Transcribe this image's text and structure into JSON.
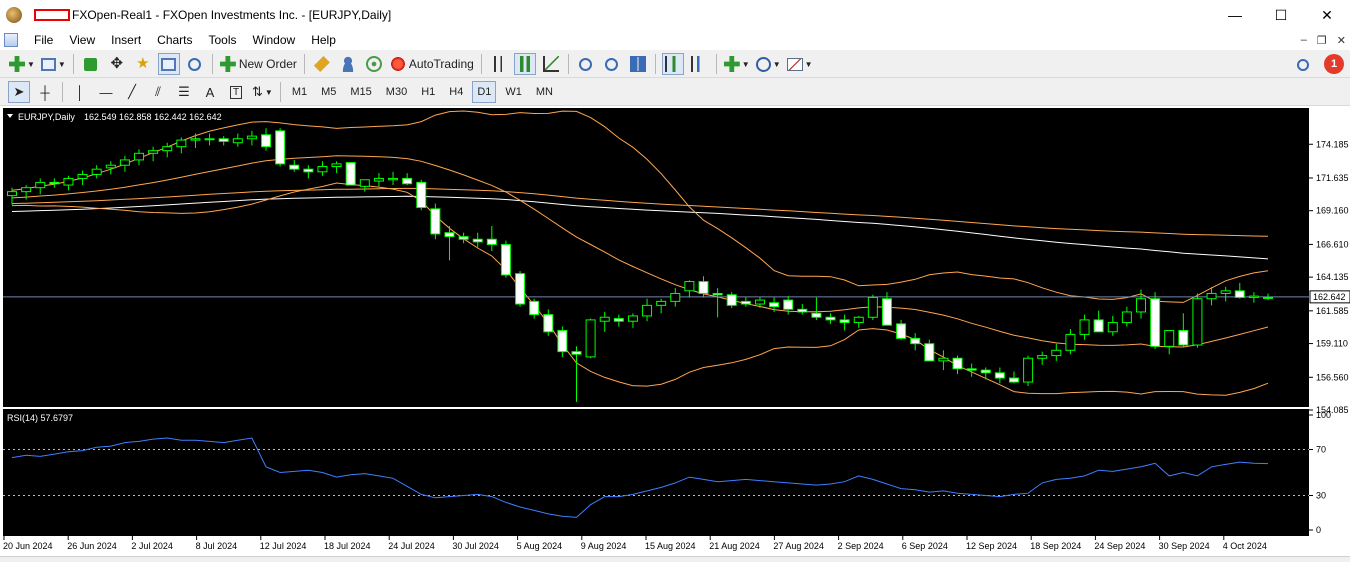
{
  "window": {
    "title": "FXOpen-Real1 - FXOpen Investments Inc. - [EURJPY,Daily]",
    "controls": {
      "minimize": "—",
      "maximize": "☐",
      "close": "✕"
    }
  },
  "menu": {
    "items": [
      "File",
      "View",
      "Insert",
      "Charts",
      "Tools",
      "Window",
      "Help"
    ],
    "mdi": {
      "minimize": "–",
      "restore": "❐",
      "close": "✕"
    }
  },
  "toolbar": {
    "new_order": "New Order",
    "auto_trading": "AutoTrading",
    "notification_count": "1"
  },
  "timeframes": [
    "M1",
    "M5",
    "M15",
    "M30",
    "H1",
    "H4",
    "D1",
    "W1",
    "MN"
  ],
  "active_timeframe": "D1",
  "colors": {
    "chart_bg": "#000000",
    "bull_candle": "#000000",
    "bear_candle": "#ffffff",
    "wick": "#00ff00",
    "bollinger": "#ffa64d",
    "ma": "#ffffff",
    "rsi_line": "#3f7fff",
    "current_price_line": "#6f87b0"
  },
  "chart": {
    "symbol_header": "EURJPY,Daily",
    "ohlc": "162.549 162.858 162.442 162.642",
    "current_price": "162.642",
    "price_axis": [
      "174.185",
      "171.635",
      "169.160",
      "166.610",
      "164.135",
      "161.585",
      "159.110",
      "156.560",
      "154.085"
    ],
    "date_axis": [
      "20 Jun 2024",
      "26 Jun 2024",
      "2 Jul 2024",
      "8 Jul 2024",
      "12 Jul 2024",
      "18 Jul 2024",
      "24 Jul 2024",
      "30 Jul 2024",
      "5 Aug 2024",
      "9 Aug 2024",
      "15 Aug 2024",
      "21 Aug 2024",
      "27 Aug 2024",
      "2 Sep 2024",
      "6 Sep 2024",
      "12 Sep 2024",
      "18 Sep 2024",
      "24 Sep 2024",
      "30 Sep 2024",
      "4 Oct 2024"
    ]
  },
  "rsi": {
    "label": "RSI(14) 57.6797",
    "axis": [
      "100",
      "70",
      "30",
      "0"
    ],
    "levels": [
      70,
      30
    ]
  },
  "chart_data": {
    "type": "candlestick",
    "y_range": [
      154.085,
      176.7
    ],
    "candles": [
      [
        170.3,
        170.9,
        169.6,
        170.6
      ],
      [
        170.6,
        171.1,
        170.0,
        170.9
      ],
      [
        170.9,
        171.6,
        170.4,
        171.3
      ],
      [
        171.3,
        171.6,
        170.9,
        171.2
      ],
      [
        171.1,
        171.8,
        170.7,
        171.6
      ],
      [
        171.6,
        172.2,
        171.1,
        171.9
      ],
      [
        171.9,
        172.6,
        171.6,
        172.3
      ],
      [
        172.4,
        172.9,
        171.9,
        172.6
      ],
      [
        172.6,
        173.3,
        172.1,
        173.0
      ],
      [
        173.0,
        173.8,
        172.6,
        173.5
      ],
      [
        173.5,
        174.0,
        172.9,
        173.7
      ],
      [
        173.7,
        174.3,
        173.2,
        174.0
      ],
      [
        174.0,
        174.7,
        173.5,
        174.5
      ],
      [
        174.5,
        175.0,
        173.9,
        174.6
      ],
      [
        174.6,
        175.0,
        174.1,
        174.6
      ],
      [
        174.6,
        174.8,
        174.1,
        174.4
      ],
      [
        174.3,
        175.0,
        174.0,
        174.6
      ],
      [
        174.6,
        175.2,
        174.1,
        174.8
      ],
      [
        174.9,
        175.4,
        173.7,
        174.0
      ],
      [
        175.2,
        175.4,
        172.5,
        172.7
      ],
      [
        172.6,
        173.0,
        172.1,
        172.3
      ],
      [
        172.3,
        172.6,
        171.6,
        172.1
      ],
      [
        172.1,
        172.9,
        171.8,
        172.5
      ],
      [
        172.5,
        172.9,
        172.0,
        172.7
      ],
      [
        172.8,
        172.8,
        171.2,
        171.1
      ],
      [
        171.0,
        171.4,
        170.6,
        171.5
      ],
      [
        171.4,
        172.0,
        171.0,
        171.6
      ],
      [
        171.5,
        172.1,
        171.1,
        171.6
      ],
      [
        171.6,
        172.0,
        171.1,
        171.2
      ],
      [
        171.3,
        171.5,
        169.2,
        169.4
      ],
      [
        169.3,
        169.7,
        167.0,
        167.4
      ],
      [
        167.5,
        168.0,
        165.4,
        167.2
      ],
      [
        167.2,
        167.5,
        166.7,
        167.0
      ],
      [
        167.0,
        167.5,
        166.4,
        166.8
      ],
      [
        167.0,
        168.0,
        166.1,
        166.6
      ],
      [
        166.6,
        166.9,
        164.1,
        164.3
      ],
      [
        164.4,
        164.6,
        161.9,
        162.1
      ],
      [
        162.3,
        162.5,
        161.0,
        161.3
      ],
      [
        161.3,
        161.7,
        159.7,
        160.0
      ],
      [
        160.1,
        160.4,
        158.1,
        158.5
      ],
      [
        158.5,
        158.9,
        154.7,
        158.3
      ],
      [
        158.1,
        161.0,
        158.0,
        160.9
      ],
      [
        160.8,
        161.5,
        160.0,
        161.1
      ],
      [
        161.0,
        161.3,
        160.4,
        160.8
      ],
      [
        160.8,
        161.4,
        160.3,
        161.2
      ],
      [
        161.2,
        162.5,
        160.8,
        162.0
      ],
      [
        162.0,
        162.5,
        161.4,
        162.3
      ],
      [
        162.3,
        163.3,
        161.9,
        162.9
      ],
      [
        163.1,
        163.9,
        162.6,
        163.8
      ],
      [
        163.8,
        164.2,
        162.6,
        162.9
      ],
      [
        162.9,
        163.3,
        161.1,
        162.8
      ],
      [
        162.8,
        163.0,
        161.8,
        162.0
      ],
      [
        162.3,
        162.6,
        161.9,
        162.1
      ],
      [
        162.1,
        162.6,
        161.8,
        162.4
      ],
      [
        162.2,
        162.6,
        161.5,
        161.9
      ],
      [
        162.4,
        162.7,
        161.3,
        161.7
      ],
      [
        161.7,
        162.1,
        161.3,
        161.5
      ],
      [
        161.4,
        162.6,
        160.9,
        161.1
      ],
      [
        161.1,
        161.4,
        160.6,
        160.9
      ],
      [
        160.9,
        161.3,
        160.1,
        160.7
      ],
      [
        160.7,
        161.2,
        160.3,
        161.1
      ],
      [
        161.1,
        162.8,
        160.9,
        162.6
      ],
      [
        162.5,
        163.0,
        161.0,
        160.5
      ],
      [
        160.6,
        160.9,
        159.4,
        159.5
      ],
      [
        159.5,
        159.9,
        158.6,
        159.1
      ],
      [
        159.1,
        159.4,
        157.9,
        157.8
      ],
      [
        157.8,
        158.6,
        157.1,
        158.0
      ],
      [
        158.0,
        158.2,
        156.8,
        157.2
      ],
      [
        157.2,
        157.6,
        156.6,
        157.1
      ],
      [
        157.1,
        157.3,
        156.4,
        156.9
      ],
      [
        156.9,
        157.3,
        156.1,
        156.5
      ],
      [
        156.5,
        157.0,
        156.1,
        156.2
      ],
      [
        156.2,
        158.2,
        155.9,
        158.0
      ],
      [
        158.0,
        158.5,
        157.5,
        158.2
      ],
      [
        158.2,
        159.1,
        157.8,
        158.6
      ],
      [
        158.6,
        160.2,
        158.3,
        159.8
      ],
      [
        159.8,
        161.3,
        159.4,
        160.9
      ],
      [
        160.9,
        161.6,
        160.3,
        160.0
      ],
      [
        160.0,
        161.2,
        159.7,
        160.7
      ],
      [
        160.7,
        161.9,
        160.4,
        161.5
      ],
      [
        161.5,
        163.2,
        161.0,
        162.5
      ],
      [
        162.5,
        163.0,
        158.7,
        158.9
      ],
      [
        158.9,
        159.4,
        158.3,
        160.1
      ],
      [
        160.1,
        161.4,
        158.8,
        159.0
      ],
      [
        159.0,
        162.9,
        158.8,
        162.5
      ],
      [
        162.5,
        163.4,
        162.0,
        162.9
      ],
      [
        162.9,
        163.4,
        162.3,
        163.1
      ],
      [
        163.1,
        163.7,
        162.5,
        162.6
      ],
      [
        162.6,
        163.0,
        162.2,
        162.7
      ],
      [
        162.6,
        162.9,
        162.4,
        162.6
      ]
    ],
    "rsi_values": [
      63,
      65,
      64,
      66,
      68,
      69,
      72,
      73,
      76,
      77,
      79,
      80,
      78,
      78,
      77,
      76,
      78,
      80,
      55,
      50,
      51,
      52,
      50,
      46,
      48,
      49,
      47,
      45,
      38,
      31,
      28,
      29,
      30,
      31,
      29,
      24,
      20,
      17,
      14,
      12,
      11,
      22,
      29,
      29,
      31,
      34,
      37,
      41,
      46,
      44,
      42,
      43,
      44,
      43,
      42,
      41,
      40,
      39,
      40,
      42,
      47,
      44,
      40,
      36,
      35,
      33,
      34,
      32,
      31,
      30,
      29,
      31,
      32,
      41,
      44,
      45,
      47,
      52,
      51,
      53,
      55,
      58,
      47,
      50,
      47,
      55,
      57,
      59,
      58,
      57.7
    ]
  }
}
